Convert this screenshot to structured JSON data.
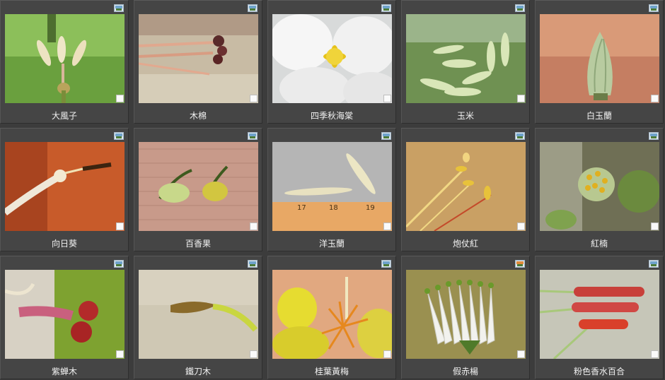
{
  "gallery": {
    "items": [
      {
        "caption": "大風子"
      },
      {
        "caption": "木棉"
      },
      {
        "caption": "四季秋海棠"
      },
      {
        "caption": "玉米"
      },
      {
        "caption": "白玉蘭"
      },
      {
        "caption": "向日葵"
      },
      {
        "caption": "百香果"
      },
      {
        "caption": "洋玉蘭"
      },
      {
        "caption": "炮仗紅"
      },
      {
        "caption": "紅楠"
      },
      {
        "caption": "紫蝉木"
      },
      {
        "caption": "鐵刀木"
      },
      {
        "caption": "桂葉黃梅"
      },
      {
        "caption": "假赤楊"
      },
      {
        "caption": "粉色香水百合"
      }
    ],
    "ruler_marks": [
      "17",
      "18",
      "19"
    ]
  }
}
